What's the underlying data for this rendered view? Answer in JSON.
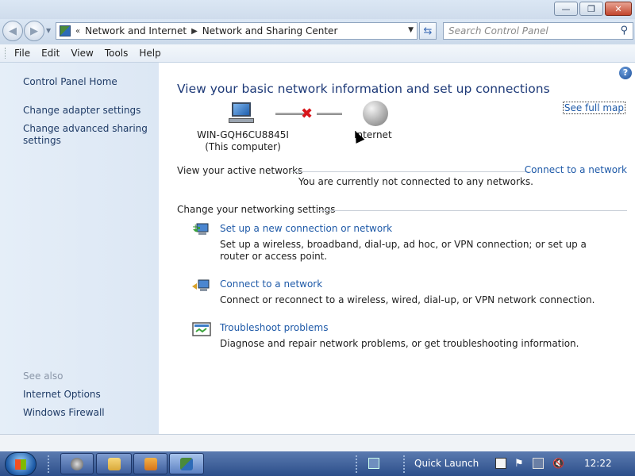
{
  "window": {
    "minimize_glyph": "—",
    "maximize_glyph": "❐",
    "close_glyph": "✕"
  },
  "address_bar": {
    "overflow_glyph": "«",
    "crumbs": [
      "Network and Internet",
      "Network and Sharing Center"
    ],
    "search_placeholder": "Search Control Panel"
  },
  "menu": {
    "items": [
      "File",
      "Edit",
      "View",
      "Tools",
      "Help"
    ]
  },
  "sidebar": {
    "home": "Control Panel Home",
    "links": [
      "Change adapter settings",
      "Change advanced sharing settings"
    ],
    "see_also_header": "See also",
    "see_also": [
      "Internet Options",
      "Windows Firewall"
    ]
  },
  "main": {
    "title": "View your basic network information and set up connections",
    "see_full_map": "See full map",
    "computer_name": "WIN-GQH6CU8845I",
    "computer_sub": "(This computer)",
    "internet_label": "Internet",
    "active_networks_header": "View your active networks",
    "connect_link": "Connect to a network",
    "not_connected": "You are currently not connected to any networks.",
    "settings_header": "Change your networking settings",
    "tasks": [
      {
        "icon": "setup-connection-icon",
        "link": "Set up a new connection or network",
        "desc": "Set up a wireless, broadband, dial-up, ad hoc, or VPN connection; or set up a router or access point."
      },
      {
        "icon": "connect-network-icon",
        "link": "Connect to a network",
        "desc": "Connect or reconnect to a wireless, wired, dial-up, or VPN network connection."
      },
      {
        "icon": "troubleshoot-icon",
        "link": "Troubleshoot problems",
        "desc": "Diagnose and repair network problems, or get troubleshooting information."
      }
    ]
  },
  "taskbar": {
    "quick_launch": "Quick Launch",
    "clock": "12:22"
  },
  "colors": {
    "link": "#1f5aa8",
    "title": "#1e3a78",
    "sidebar_bg": "#e2ecf7",
    "taskbar": "#3a5c98",
    "error_x": "#d8161b"
  }
}
